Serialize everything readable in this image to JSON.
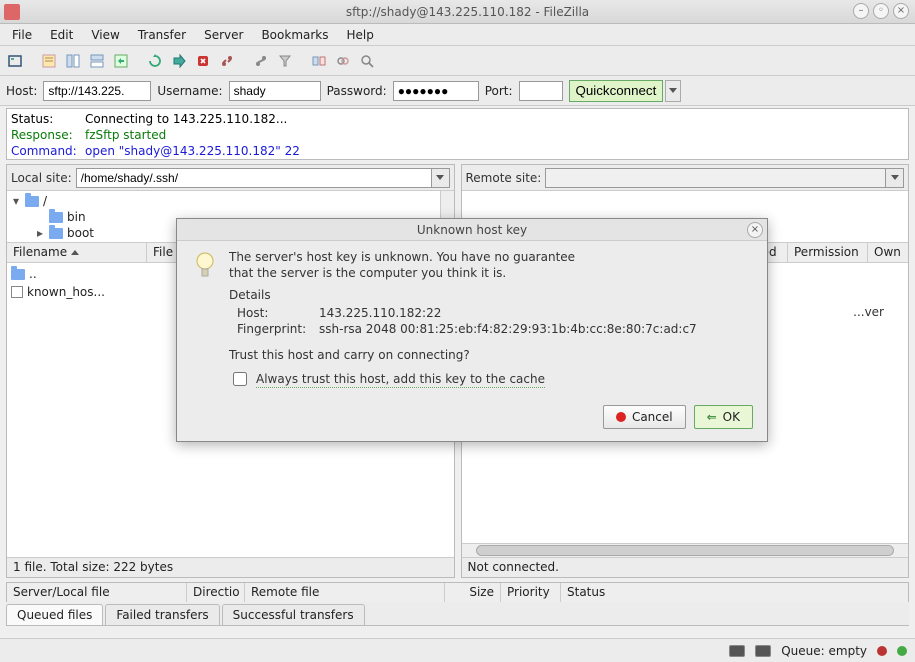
{
  "window_title": "sftp://shady@143.225.110.182 - FileZilla",
  "menu": [
    "File",
    "Edit",
    "View",
    "Transfer",
    "Server",
    "Bookmarks",
    "Help"
  ],
  "qc": {
    "host_label": "Host:",
    "host_value": "sftp://143.225.",
    "user_label": "Username:",
    "user_value": "shady",
    "pass_label": "Password:",
    "pass_value": "●●●●●●●",
    "port_label": "Port:",
    "port_value": "",
    "btn": "Quickconnect"
  },
  "log": {
    "rows": [
      {
        "label": "Status:",
        "style": "st",
        "text": "Connecting to 143.225.110.182..."
      },
      {
        "label": "Response:",
        "style": "rp",
        "text": "fzSftp started"
      },
      {
        "label": "Command:",
        "style": "cmd",
        "text": "open \"shady@143.225.110.182\" 22"
      }
    ]
  },
  "local": {
    "label": "Local site:",
    "path": "/home/shady/.ssh/",
    "root": "/",
    "tree": [
      "bin",
      "boot"
    ],
    "cols": [
      "Filename",
      "File"
    ],
    "files": [
      {
        "name": ".."
      },
      {
        "name": "known_hos..."
      }
    ],
    "footer": "1 file. Total size: 222 bytes"
  },
  "remote": {
    "label": "Remote site:",
    "path": "",
    "cols": [
      "...",
      "fied",
      "Permission",
      "Own"
    ],
    "msg": "...ver",
    "footer": "Not connected."
  },
  "xfer": {
    "cols": [
      "Server/Local file",
      "Directio",
      "Remote file",
      "Size",
      "Priority",
      "Status"
    ],
    "tabs": [
      "Queued files",
      "Failed transfers",
      "Successful transfers"
    ]
  },
  "statusbar": {
    "queue": "Queue: empty"
  },
  "dialog": {
    "title": "Unknown host key",
    "msg1": "The server's host key is unknown. You have no guarantee",
    "msg2": "that the server is the computer you think it is.",
    "details_label": "Details",
    "host_lbl": "Host:",
    "host_val": "143.225.110.182:22",
    "fp_lbl": "Fingerprint:",
    "fp_val": "ssh-rsa 2048 00:81:25:eb:f4:82:29:93:1b:4b:cc:8e:80:7c:ad:c7",
    "prompt": "Trust this host and carry on connecting?",
    "checkbox": "Always trust this host, add this key to the cache",
    "cancel": "Cancel",
    "ok": "OK"
  }
}
